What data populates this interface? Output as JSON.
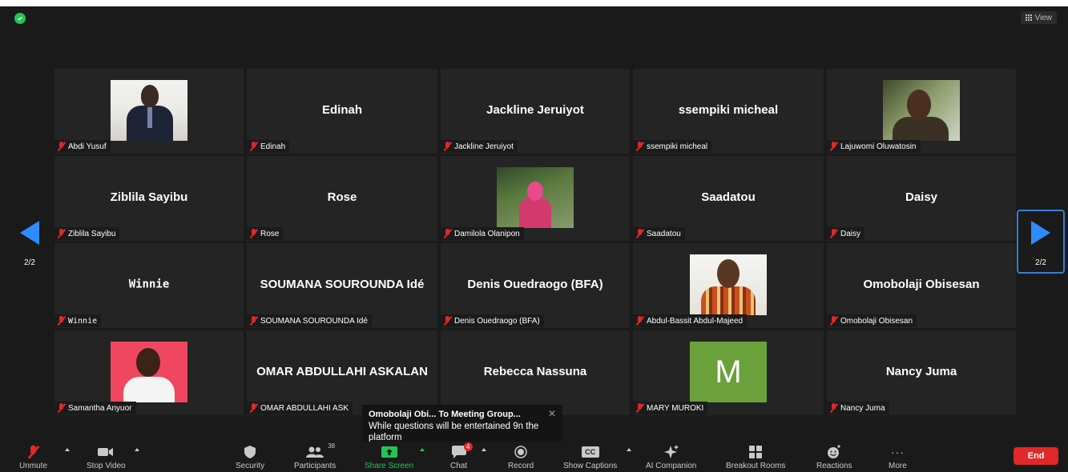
{
  "window": {
    "view_label": "View"
  },
  "pagination": {
    "left_page": "2/2",
    "right_page": "2/2"
  },
  "tiles": [
    {
      "display_name": "",
      "tag_name": "Abdi Yusuf",
      "photo": "man-in-suit"
    },
    {
      "display_name": "Edinah",
      "tag_name": "Edinah"
    },
    {
      "display_name": "Jackline Jeruiyot",
      "tag_name": "Jackline Jeruiyot"
    },
    {
      "display_name": "ssempiki micheal",
      "tag_name": "ssempiki micheal"
    },
    {
      "display_name": "",
      "tag_name": "Lajuwomi Oluwatosin",
      "photo": "young-man-closeup"
    },
    {
      "display_name": "Ziblila Sayibu",
      "tag_name": "Ziblila Sayibu"
    },
    {
      "display_name": "Rose",
      "tag_name": "Rose"
    },
    {
      "display_name": "",
      "tag_name": "Damilola Olanipon",
      "photo": "woman-in-hijab-outdoors"
    },
    {
      "display_name": "Saadatou",
      "tag_name": "Saadatou"
    },
    {
      "display_name": "Daisy",
      "tag_name": "Daisy"
    },
    {
      "display_name": "Winnie",
      "tag_name": "Winnie"
    },
    {
      "display_name": "SOUMANA SOUROUNDA Idé",
      "tag_name": "SOUMANA SOUROUNDA Idé"
    },
    {
      "display_name": "Denis Ouedraogo (BFA)",
      "tag_name": "Denis Ouedraogo (BFA)"
    },
    {
      "display_name": "",
      "tag_name": "Abdul-Bassit Abdul-Majeed",
      "photo": "man-in-patterned-shirt"
    },
    {
      "display_name": "Omobolaji Obisesan",
      "tag_name": "Omobolaji Obisesan"
    },
    {
      "display_name": "",
      "tag_name": "Samantha Anyuor",
      "photo": "smiling-woman-pink-background"
    },
    {
      "display_name": "OMAR ABDULLAHI ASKALAN",
      "tag_name": "OMAR ABDULLAHI ASK"
    },
    {
      "display_name": "Rebecca Nassuna",
      "tag_name": ""
    },
    {
      "display_name": "",
      "tag_name": "MARY MUROKI",
      "avatar_letter": "M",
      "avatar_color": "#6aa13a"
    },
    {
      "display_name": "Nancy Juma",
      "tag_name": "Nancy Juma"
    }
  ],
  "chat_preview": {
    "from": "Omobolaji Obi... To Meeting Group...",
    "message": "While questions will be entertained 9n the platform"
  },
  "toolbar": {
    "unmute": "Unmute",
    "stop_video": "Stop Video",
    "security": "Security",
    "participants": "Participants",
    "participants_count": "38",
    "share_screen": "Share Screen",
    "chat": "Chat",
    "chat_badge": "4",
    "record": "Record",
    "show_captions": "Show Captions",
    "ai_companion": "AI Companion",
    "breakout_rooms": "Breakout Rooms",
    "reactions": "Reactions",
    "more": "More",
    "end": "End",
    "cc_glyph": "CC",
    "more_glyph": "···"
  },
  "colors": {
    "background": "#1a1a1a",
    "tile": "#242424",
    "accent_blue": "#2d8cff",
    "share_green": "#23c552",
    "end_red": "#e02828"
  }
}
